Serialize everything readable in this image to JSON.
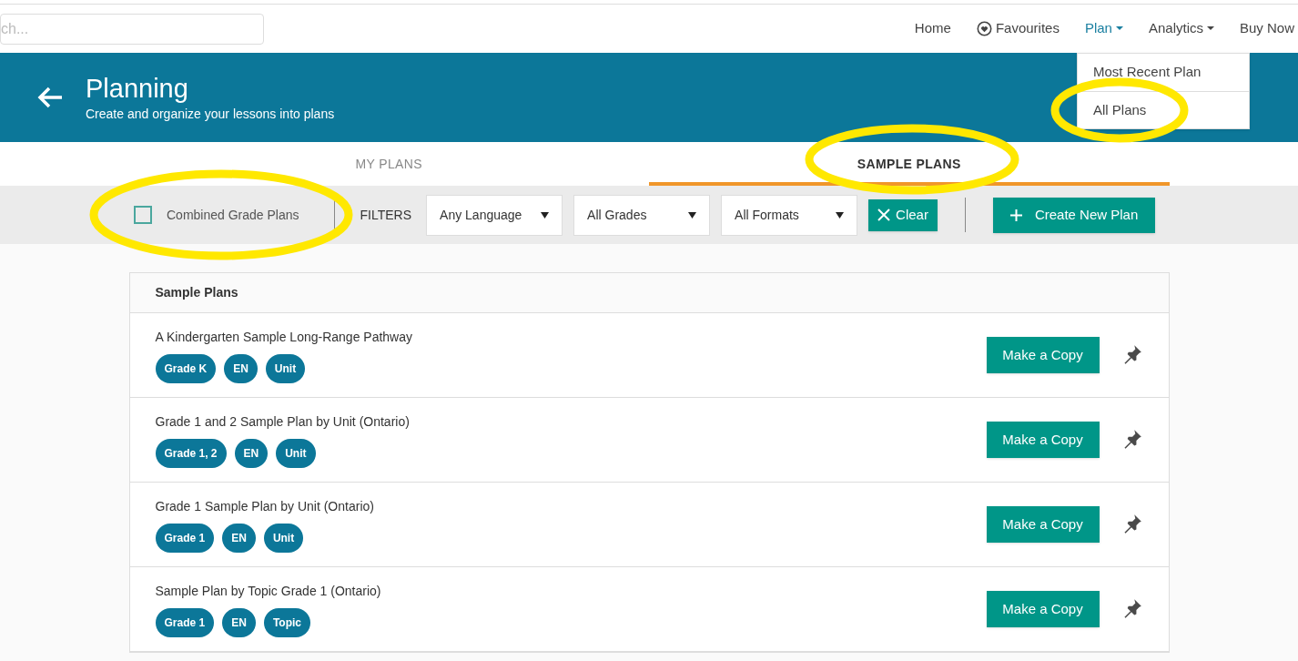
{
  "search": {
    "placeholder": "ch..."
  },
  "nav": [
    {
      "label": "Home",
      "kind": "link",
      "selected": false
    },
    {
      "label": "Favourites",
      "kind": "heart",
      "selected": false
    },
    {
      "label": "Plan",
      "kind": "dropdown",
      "selected": true
    },
    {
      "label": "Analytics",
      "kind": "dropdown",
      "selected": false
    },
    {
      "label": "Buy Now",
      "kind": "link",
      "selected": false
    }
  ],
  "plan_menu": [
    "Most Recent Plan",
    "All Plans"
  ],
  "header": {
    "title": "Planning",
    "subtitle": "Create and organize your lessons into plans"
  },
  "tabs": [
    {
      "label": "MY PLANS",
      "selected": false
    },
    {
      "label": "SAMPLE PLANS",
      "selected": true
    }
  ],
  "filter_bar": {
    "combined_checkbox": {
      "label": "Combined Grade Plans",
      "checked": false
    },
    "filters_label": "FILTERS",
    "selects": [
      "Any Language",
      "All Grades",
      "All Formats"
    ],
    "clear_button": "Clear",
    "create_button": "Create New Plan"
  },
  "list": {
    "title": "Sample Plans",
    "rows": [
      {
        "title": "A Kindergarten Sample Long-Range Pathway",
        "tags": [
          "Grade K",
          "EN",
          "Unit"
        ],
        "copy_button": "Make a Copy"
      },
      {
        "title": "Grade 1 and 2 Sample Plan by Unit (Ontario)",
        "tags": [
          "Grade 1, 2",
          "EN",
          "Unit"
        ],
        "copy_button": "Make a Copy"
      },
      {
        "title": "Grade 1 Sample Plan by Unit (Ontario)",
        "tags": [
          "Grade 1",
          "EN",
          "Unit"
        ],
        "copy_button": "Make a Copy"
      },
      {
        "title": "Sample Plan by Topic Grade 1 (Ontario)",
        "tags": [
          "Grade 1",
          "EN",
          "Topic"
        ],
        "copy_button": "Make a Copy"
      }
    ]
  }
}
